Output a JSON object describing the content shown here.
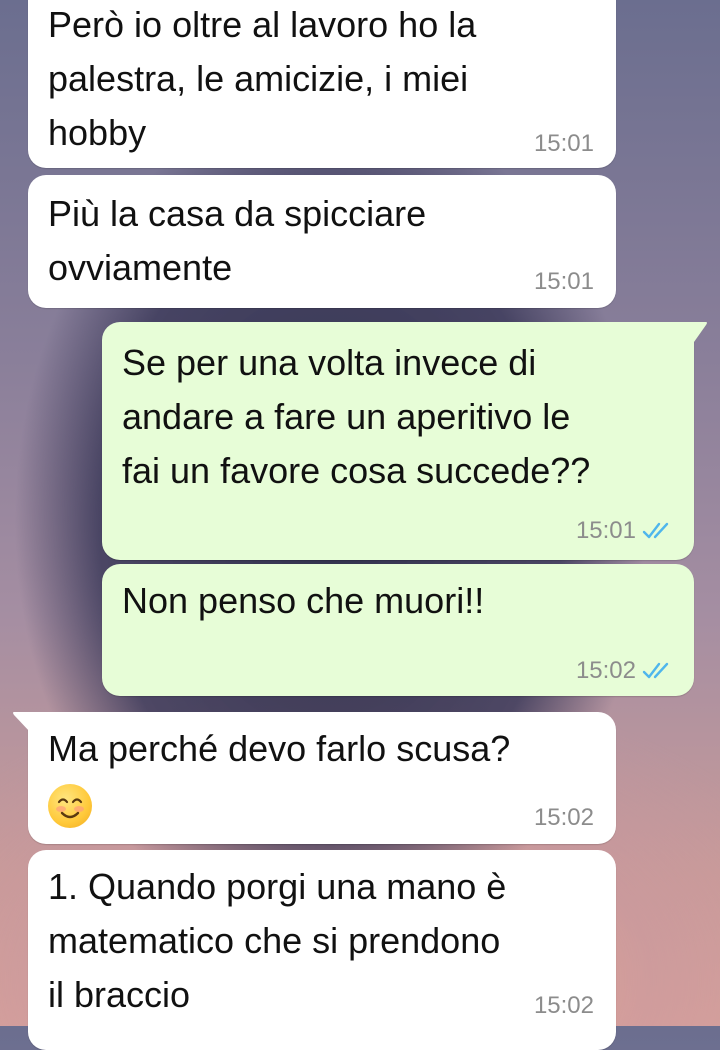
{
  "messages": [
    {
      "direction": "in",
      "text": "Però io oltre al lavoro ho la\npalestra, le amicizie, i miei\nhobby",
      "time": "15:01"
    },
    {
      "direction": "in",
      "text": "Più la casa da spicciare\novviamente",
      "time": "15:01"
    },
    {
      "direction": "out",
      "text": "Se per una volta invece di\nandare a fare un aperitivo le\nfai un favore cosa succede??",
      "time": "15:01",
      "status": "read"
    },
    {
      "direction": "out",
      "text": "Non penso che muori!!",
      "time": "15:02",
      "status": "read"
    },
    {
      "direction": "in",
      "text": "Ma perché devo farlo scusa?",
      "emoji": "😊",
      "time": "15:02"
    },
    {
      "direction": "in",
      "text": "1. Quando porgi una mano è\nmatematico che si prendono\nil braccio",
      "time": "15:02"
    }
  ],
  "colors": {
    "incoming_bubble": "#ffffff",
    "outgoing_bubble": "#e7fdd7",
    "read_ticks": "#4fb6ec",
    "timestamp": "#8c8c8c"
  },
  "icons": {
    "read_status": "double-check-icon"
  }
}
